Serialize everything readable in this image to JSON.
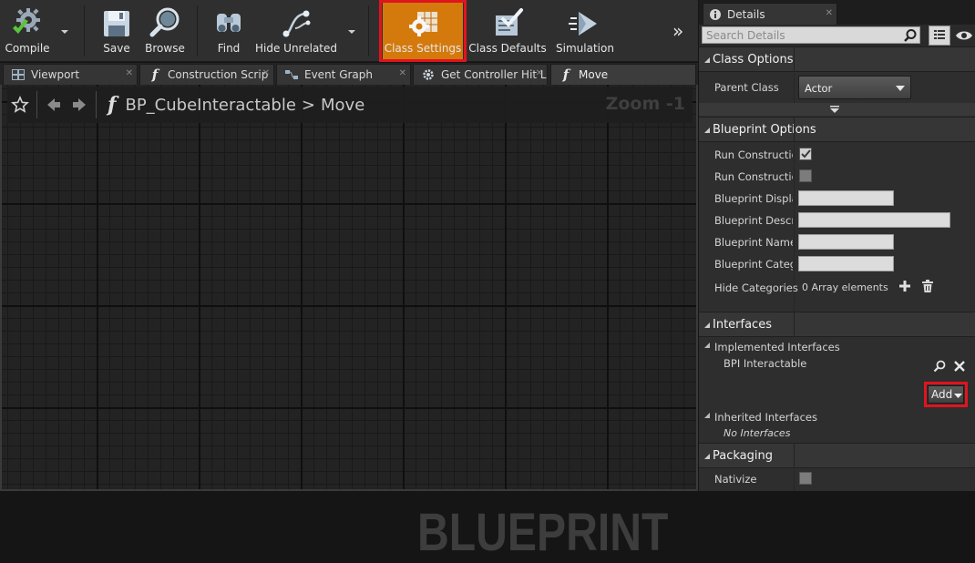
{
  "toolbar": {
    "compile": "Compile",
    "save": "Save",
    "browse": "Browse",
    "find": "Find",
    "hide_unrelated": "Hide Unrelated",
    "class_settings": "Class Settings",
    "class_defaults": "Class Defaults",
    "simulation": "Simulation",
    "overflow": "»"
  },
  "tabs": [
    {
      "label": "Viewport"
    },
    {
      "label": "Construction Scrip"
    },
    {
      "label": "Event Graph"
    },
    {
      "label": "Get Controller Hit L"
    },
    {
      "label": "Move"
    }
  ],
  "graph": {
    "breadcrumb_root": "BP_CubeInteractable",
    "breadcrumb_sep": ">",
    "breadcrumb_leaf": "Move",
    "function_glyph": "f",
    "zoom": "Zoom -1",
    "watermark": "BLUEPRINT"
  },
  "details": {
    "tab_label": "Details",
    "search_placeholder": "Search Details",
    "class_options": {
      "title": "Class Options",
      "parent_class_label": "Parent Class",
      "parent_class_value": "Actor"
    },
    "blueprint_options": {
      "title": "Blueprint Options",
      "rows": [
        {
          "label": "Run Construction"
        },
        {
          "label": "Run Construction"
        },
        {
          "label": "Blueprint Display"
        },
        {
          "label": "Blueprint Descript"
        },
        {
          "label": "Blueprint Namesp"
        },
        {
          "label": "Blueprint Categor"
        }
      ],
      "hide_categories_label": "Hide Categories",
      "hide_categories_value": "0 Array elements"
    },
    "interfaces": {
      "title": "Interfaces",
      "implemented_label": "Implemented Interfaces",
      "implemented_item": "BPI Interactable",
      "add_label": "Add",
      "inherited_label": "Inherited Interfaces",
      "inherited_value": "No Interfaces"
    },
    "packaging": {
      "title": "Packaging",
      "nativize_label": "Nativize"
    }
  },
  "colors": {
    "highlight": "#e0141e",
    "active_button": "#d47a0c"
  }
}
